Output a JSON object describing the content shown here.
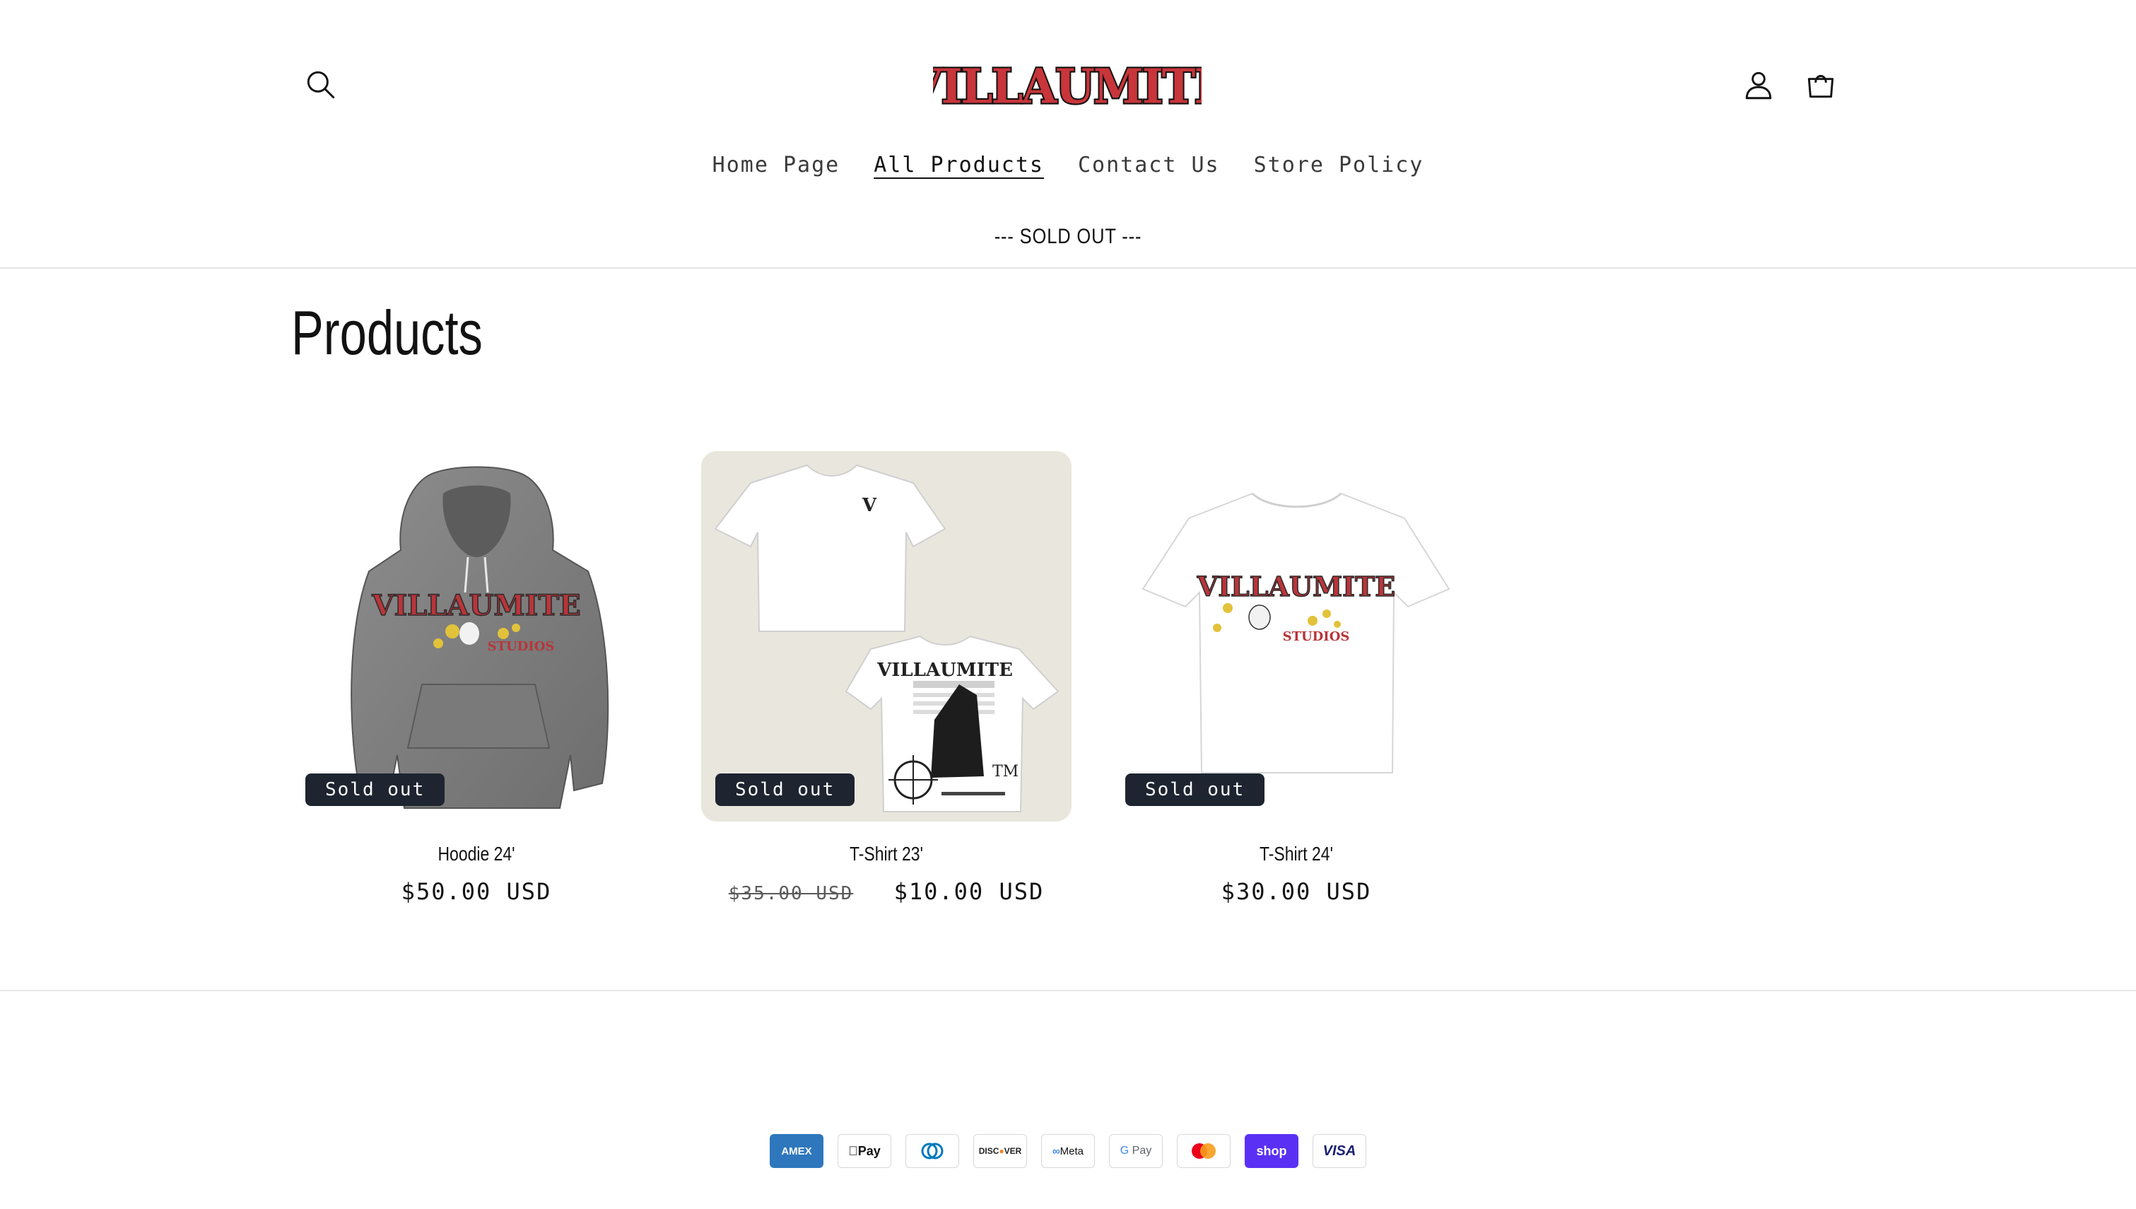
{
  "header": {
    "logo_text": "VILLAUMITE",
    "nav": [
      {
        "label": "Home Page"
      },
      {
        "label": "All Products"
      },
      {
        "label": "Contact Us"
      },
      {
        "label": "Store Policy"
      }
    ],
    "active_nav": "All Products",
    "announcement": "--- SOLD OUT ---"
  },
  "icons": {
    "search": "search-icon",
    "account": "account-icon",
    "cart": "cart-icon"
  },
  "main": {
    "title": "Products",
    "products": [
      {
        "title": "Hoodie 24'",
        "price": "$50.00 USD",
        "compare_price": "",
        "badge": "Sold out"
      },
      {
        "title": "T-Shirt 23'",
        "price": "$10.00 USD",
        "compare_price": "$35.00 USD",
        "badge": "Sold out"
      },
      {
        "title": "T-Shirt 24'",
        "price": "$30.00 USD",
        "compare_price": "",
        "badge": "Sold out"
      }
    ]
  },
  "footer": {
    "payment_methods": [
      "American Express",
      "Apple Pay",
      "Diners Club",
      "Discover",
      "Meta Pay",
      "Google Pay",
      "Mastercard",
      "Shop Pay",
      "Visa"
    ]
  },
  "colors": {
    "badge_bg": "#1e2430",
    "logo_red": "#c8353a",
    "text": "#121212"
  }
}
